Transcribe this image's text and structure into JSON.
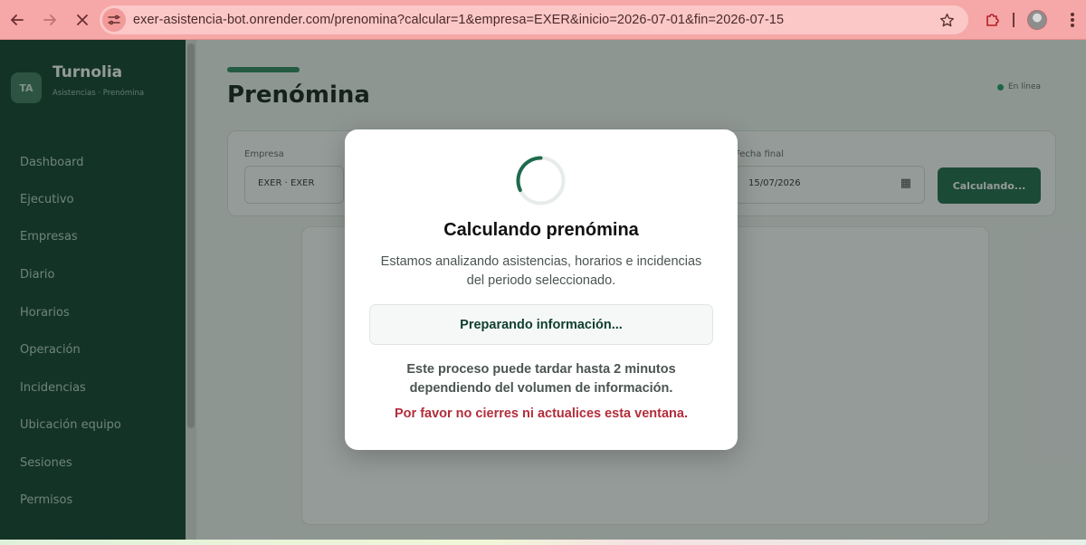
{
  "browser": {
    "url": "exer-asistencia-bot.onrender.com/prenomina?calcular=1&empresa=EXER&inicio=2026-07-01&fin=2026-07-15",
    "back_icon": "arrow-left-icon",
    "forward_icon": "arrow-right-icon",
    "stop_icon": "close-icon",
    "bookmark_icon": "star-icon",
    "extensions_icon": "puzzle-icon",
    "menu_icon": "kebab-menu-icon",
    "chrome_color": "#f6a7a7"
  },
  "sidebar": {
    "logo_text": "TA",
    "brand_name": "Turnolia",
    "brand_subtitle": "Asistencias · Prenómina",
    "items": [
      {
        "label": "Dashboard"
      },
      {
        "label": "Ejecutivo"
      },
      {
        "label": "Empresas"
      },
      {
        "label": "Diario"
      },
      {
        "label": "Horarios"
      },
      {
        "label": "Operación"
      },
      {
        "label": "Incidencias"
      },
      {
        "label": "Ubicación equipo"
      },
      {
        "label": "Sesiones"
      },
      {
        "label": "Permisos"
      }
    ],
    "background": "#0f3f2e"
  },
  "page": {
    "title": "Prenómina",
    "status_text": "En línea",
    "filters": {
      "company_label": "Empresa",
      "company_value": "EXER · EXER",
      "end_label": "Fecha final",
      "end_value": "15/07/2026",
      "calculate_label": "Calculando..."
    }
  },
  "modal": {
    "title": "Calculando prenómina",
    "description": "Estamos analizando asistencias, horarios e incidencias del periodo seleccionado.",
    "status": "Preparando información...",
    "note": "Este proceso puede tardar hasta 2 minutos dependiendo del volumen de información.",
    "warning": "Por favor no cierres ni actualices esta ventana.",
    "spinner_icon": "loading-spinner-icon",
    "accent_color": "#1e6a4d",
    "warning_color": "#b32d3a"
  }
}
